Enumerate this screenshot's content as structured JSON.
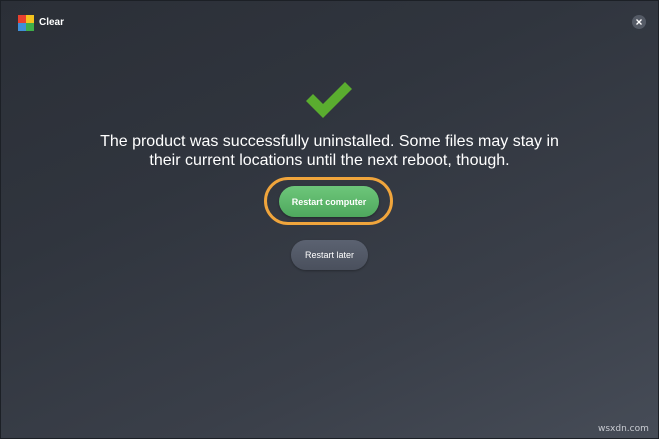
{
  "window": {
    "title": "Clear",
    "logo_icon": "avg-logo-icon",
    "close_icon": "close-icon"
  },
  "status": {
    "icon": "checkmark-icon",
    "message_lines": [
      "The product was successfully uninstalled. Some files may stay in",
      "their current locations until the next reboot, though."
    ]
  },
  "actions": {
    "restart_now_label": "Restart computer",
    "restart_later_label": "Restart later"
  },
  "watermark": "wsxdn.com",
  "colors": {
    "background": "#30353e",
    "check_green": "#5aad2f",
    "primary_button": "#5cb56a",
    "secondary_button": "#525866",
    "highlight_ring": "#f0a53c"
  }
}
